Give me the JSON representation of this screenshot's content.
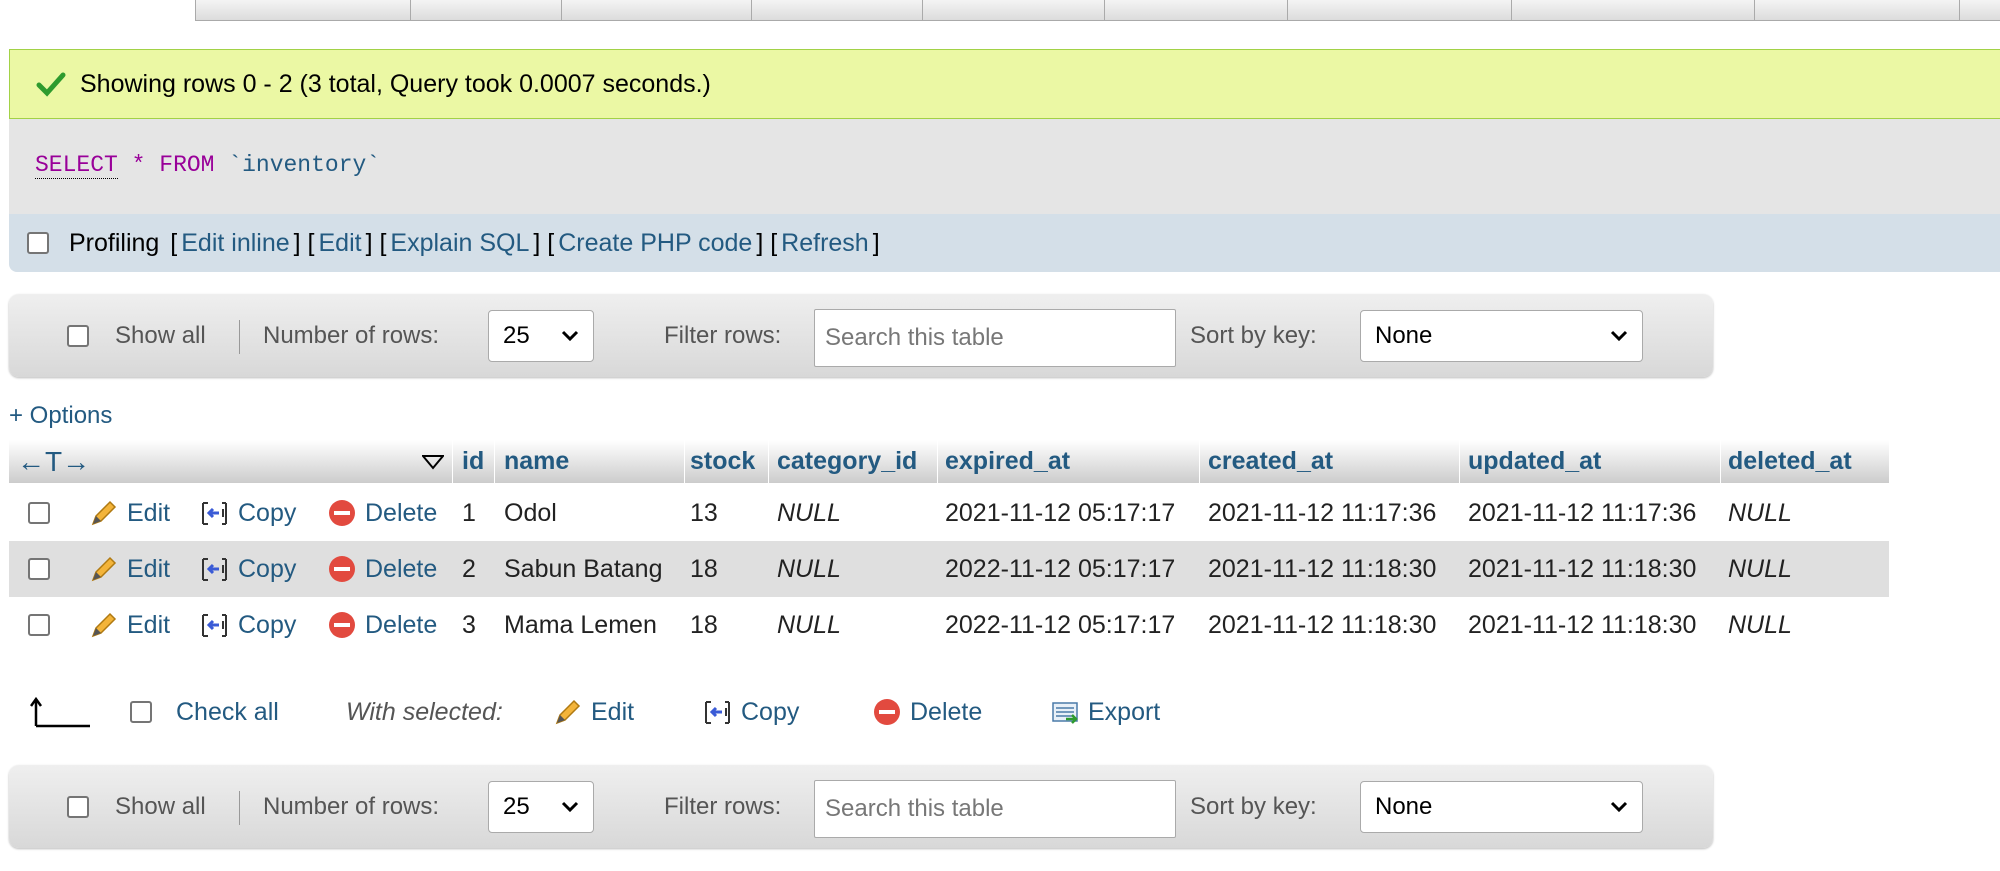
{
  "message": {
    "text": "Showing rows 0 - 2 (3 total, Query took 0.0007 seconds.)"
  },
  "sql": {
    "select": "SELECT",
    "star": "*",
    "from": "FROM",
    "table": "`inventory`"
  },
  "profiling": {
    "label": "Profiling",
    "links": [
      "Edit inline",
      "Edit",
      "Explain SQL",
      "Create PHP code",
      "Refresh"
    ]
  },
  "nav": {
    "show_all": "Show all",
    "num_rows_label": "Number of rows:",
    "num_rows_value": "25",
    "filter_label": "Filter rows:",
    "filter_placeholder": "Search this table",
    "sort_label": "Sort by key:",
    "sort_value": "None"
  },
  "options_link": "+ Options",
  "table": {
    "arrows": "←T→",
    "columns": [
      "id",
      "name",
      "stock",
      "category_id",
      "expired_at",
      "created_at",
      "updated_at",
      "deleted_at"
    ],
    "actions": {
      "edit": "Edit",
      "copy": "Copy",
      "delete": "Delete"
    },
    "rows": [
      [
        "1",
        "Odol",
        "13",
        "NULL",
        "2021-11-12 05:17:17",
        "2021-11-12 11:17:36",
        "2021-11-12 11:17:36",
        "NULL"
      ],
      [
        "2",
        "Sabun Batang",
        "18",
        "NULL",
        "2022-11-12 05:17:17",
        "2021-11-12 11:18:30",
        "2021-11-12 11:18:30",
        "NULL"
      ],
      [
        "3",
        "Mama Lemen",
        "18",
        "NULL",
        "2022-11-12 05:17:17",
        "2021-11-12 11:18:30",
        "2021-11-12 11:18:30",
        "NULL"
      ]
    ]
  },
  "bulk": {
    "check_all": "Check all",
    "with_selected": "With selected:",
    "edit": "Edit",
    "copy": "Copy",
    "delete": "Delete",
    "export": "Export"
  },
  "colors": {
    "link": "#235a81",
    "success_bg": "#ebf8a4",
    "prof_bg": "#d4dfe8",
    "row_alt": "#dfdfdf"
  }
}
